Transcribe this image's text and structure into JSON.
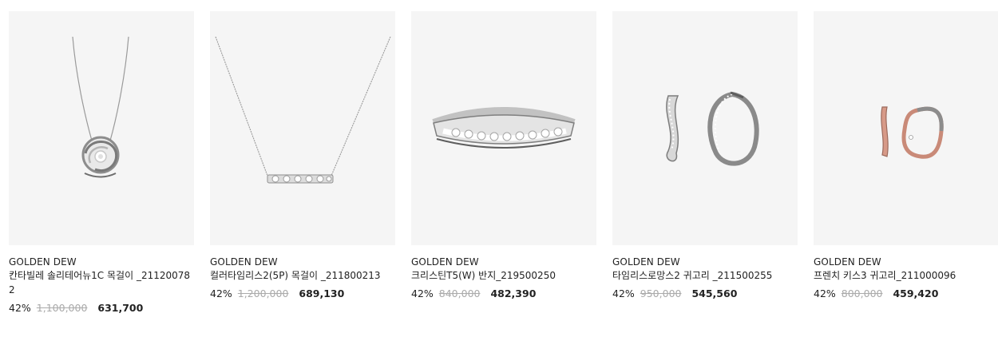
{
  "products": [
    {
      "brand": "GOLDEN DEW",
      "name": "칸타빌레 솔리테어뉴1C 목걸이 _211200782",
      "discount_rate": "42%",
      "original_price": "1,100,000",
      "sale_price": "631,700",
      "image": "necklace-solitaire-swirl"
    },
    {
      "brand": "GOLDEN DEW",
      "name": "컬러타임리스2(5P) 목걸이 _211800213",
      "discount_rate": "42%",
      "original_price": "1,200,000",
      "sale_price": "689,130",
      "image": "necklace-bar-five-stones"
    },
    {
      "brand": "GOLDEN DEW",
      "name": "크리스틴T5(W) 반지_219500250",
      "discount_rate": "42%",
      "original_price": "840,000",
      "sale_price": "482,390",
      "image": "ring-eternity-band"
    },
    {
      "brand": "GOLDEN DEW",
      "name": "타임리스로망스2 귀고리 _211500255",
      "discount_rate": "42%",
      "original_price": "950,000",
      "sale_price": "545,560",
      "image": "earrings-twisted-hoop"
    },
    {
      "brand": "GOLDEN DEW",
      "name": "프렌치 키스3 귀고리_211000096",
      "discount_rate": "42%",
      "original_price": "800,000",
      "sale_price": "459,420",
      "image": "earrings-rose-gold-square-hoop"
    }
  ],
  "colors": {
    "thumb_bg": "#f5f5f5",
    "text": "#222222",
    "strike": "#aaaaaa"
  }
}
